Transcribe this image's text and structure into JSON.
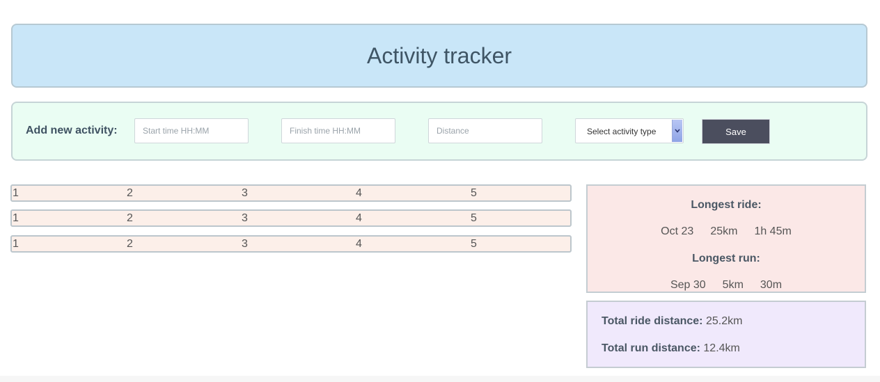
{
  "header": {
    "title": "Activity tracker"
  },
  "form": {
    "label": "Add new activity:",
    "start_placeholder": "Start time HH:MM",
    "finish_placeholder": "Finish time HH:MM",
    "distance_placeholder": "Distance",
    "select_value": "Select activity type",
    "save_label": "Save"
  },
  "rows": [
    {
      "cells": [
        "1",
        "2",
        "3",
        "4",
        "5"
      ]
    },
    {
      "cells": [
        "1",
        "2",
        "3",
        "4",
        "5"
      ]
    },
    {
      "cells": [
        "1",
        "2",
        "3",
        "4",
        "5"
      ]
    }
  ],
  "longest": {
    "ride_label": "Longest ride:",
    "ride": {
      "date": "Oct 23",
      "distance": "25km",
      "duration": "1h 45m"
    },
    "run_label": "Longest run:",
    "run": {
      "date": "Sep 30",
      "distance": "5km",
      "duration": "30m"
    }
  },
  "totals": {
    "ride_label": "Total ride distance:",
    "ride_value": "25.2km",
    "run_label": "Total run distance:",
    "run_value": "12.4km"
  },
  "colors": {
    "header_bg": "#c9e6f8",
    "form_bg": "#eafdf3",
    "row_bg": "#fcefe9",
    "longest_bg": "#fbe8e7",
    "totals_bg": "#f0e9fc",
    "save_button_bg": "#4b4e5e"
  },
  "icons": {
    "select_arrow": "chevron-down-icon"
  }
}
